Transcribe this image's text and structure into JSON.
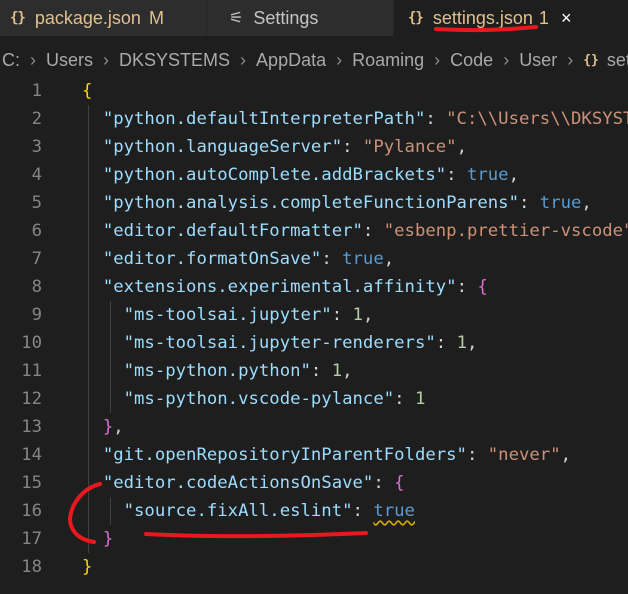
{
  "tabs": [
    {
      "label": "package.json",
      "badge": "M"
    },
    {
      "label": "Settings"
    },
    {
      "label": "settings.json",
      "badge": "1",
      "close": "×"
    }
  ],
  "breadcrumb": [
    "C:",
    "Users",
    "DKSYSTEMS",
    "AppData",
    "Roaming",
    "Code",
    "User",
    "settings.json"
  ],
  "editor_lines": [
    {
      "n": "1",
      "parts": [
        [
          "{",
          "br1"
        ]
      ]
    },
    {
      "n": "2",
      "parts": [
        [
          "  ",
          ""
        ],
        [
          "\"python.defaultInterpreterPath\"",
          "key"
        ],
        [
          ": ",
          "pun"
        ],
        [
          "\"C:\\\\Users\\\\DKSYSTEMS",
          "str"
        ]
      ]
    },
    {
      "n": "3",
      "parts": [
        [
          "  ",
          ""
        ],
        [
          "\"python.languageServer\"",
          "key"
        ],
        [
          ": ",
          "pun"
        ],
        [
          "\"Pylance\"",
          "str"
        ],
        [
          ",",
          "pun"
        ]
      ]
    },
    {
      "n": "4",
      "parts": [
        [
          "  ",
          ""
        ],
        [
          "\"python.autoComplete.addBrackets\"",
          "key"
        ],
        [
          ": ",
          "pun"
        ],
        [
          "true",
          "bool"
        ],
        [
          ",",
          "pun"
        ]
      ]
    },
    {
      "n": "5",
      "parts": [
        [
          "  ",
          ""
        ],
        [
          "\"python.analysis.completeFunctionParens\"",
          "key"
        ],
        [
          ": ",
          "pun"
        ],
        [
          "true",
          "bool"
        ],
        [
          ",",
          "pun"
        ]
      ]
    },
    {
      "n": "6",
      "parts": [
        [
          "  ",
          ""
        ],
        [
          "\"editor.defaultFormatter\"",
          "key"
        ],
        [
          ": ",
          "pun"
        ],
        [
          "\"esbenp.prettier-vscode\"",
          "str"
        ],
        [
          ",",
          "pun"
        ]
      ]
    },
    {
      "n": "7",
      "parts": [
        [
          "  ",
          ""
        ],
        [
          "\"editor.formatOnSave\"",
          "key"
        ],
        [
          ": ",
          "pun"
        ],
        [
          "true",
          "bool"
        ],
        [
          ",",
          "pun"
        ]
      ]
    },
    {
      "n": "8",
      "parts": [
        [
          "  ",
          ""
        ],
        [
          "\"extensions.experimental.affinity\"",
          "key"
        ],
        [
          ": ",
          "pun"
        ],
        [
          "{",
          "br2"
        ]
      ]
    },
    {
      "n": "9",
      "parts": [
        [
          "    ",
          ""
        ],
        [
          "\"ms-toolsai.jupyter\"",
          "key"
        ],
        [
          ": ",
          "pun"
        ],
        [
          "1",
          "num"
        ],
        [
          ",",
          "pun"
        ]
      ]
    },
    {
      "n": "10",
      "parts": [
        [
          "    ",
          ""
        ],
        [
          "\"ms-toolsai.jupyter-renderers\"",
          "key"
        ],
        [
          ": ",
          "pun"
        ],
        [
          "1",
          "num"
        ],
        [
          ",",
          "pun"
        ]
      ]
    },
    {
      "n": "11",
      "parts": [
        [
          "    ",
          ""
        ],
        [
          "\"ms-python.python\"",
          "key"
        ],
        [
          ": ",
          "pun"
        ],
        [
          "1",
          "num"
        ],
        [
          ",",
          "pun"
        ]
      ]
    },
    {
      "n": "12",
      "parts": [
        [
          "    ",
          ""
        ],
        [
          "\"ms-python.vscode-pylance\"",
          "key"
        ],
        [
          ": ",
          "pun"
        ],
        [
          "1",
          "num"
        ]
      ]
    },
    {
      "n": "13",
      "parts": [
        [
          "  ",
          ""
        ],
        [
          "}",
          "br2"
        ],
        [
          ",",
          "pun"
        ]
      ]
    },
    {
      "n": "14",
      "parts": [
        [
          "  ",
          ""
        ],
        [
          "\"git.openRepositoryInParentFolders\"",
          "key"
        ],
        [
          ": ",
          "pun"
        ],
        [
          "\"never\"",
          "str"
        ],
        [
          ",",
          "pun"
        ]
      ]
    },
    {
      "n": "15",
      "parts": [
        [
          "  ",
          ""
        ],
        [
          "\"editor.codeActionsOnSave\"",
          "key"
        ],
        [
          ": ",
          "pun"
        ],
        [
          "{",
          "br2"
        ]
      ]
    },
    {
      "n": "16",
      "parts": [
        [
          "    ",
          ""
        ],
        [
          "\"source.fixAll.eslint\"",
          "key"
        ],
        [
          ": ",
          "pun"
        ],
        [
          "true",
          "bool squig"
        ]
      ]
    },
    {
      "n": "17",
      "parts": [
        [
          "  ",
          ""
        ],
        [
          "}",
          "br2"
        ]
      ]
    },
    {
      "n": "18",
      "parts": [
        [
          "}",
          "br1"
        ]
      ]
    }
  ],
  "colors": {
    "annotation": "#e8191c",
    "tab_modified": "#e2c08d",
    "background": "#1e1e1e"
  }
}
